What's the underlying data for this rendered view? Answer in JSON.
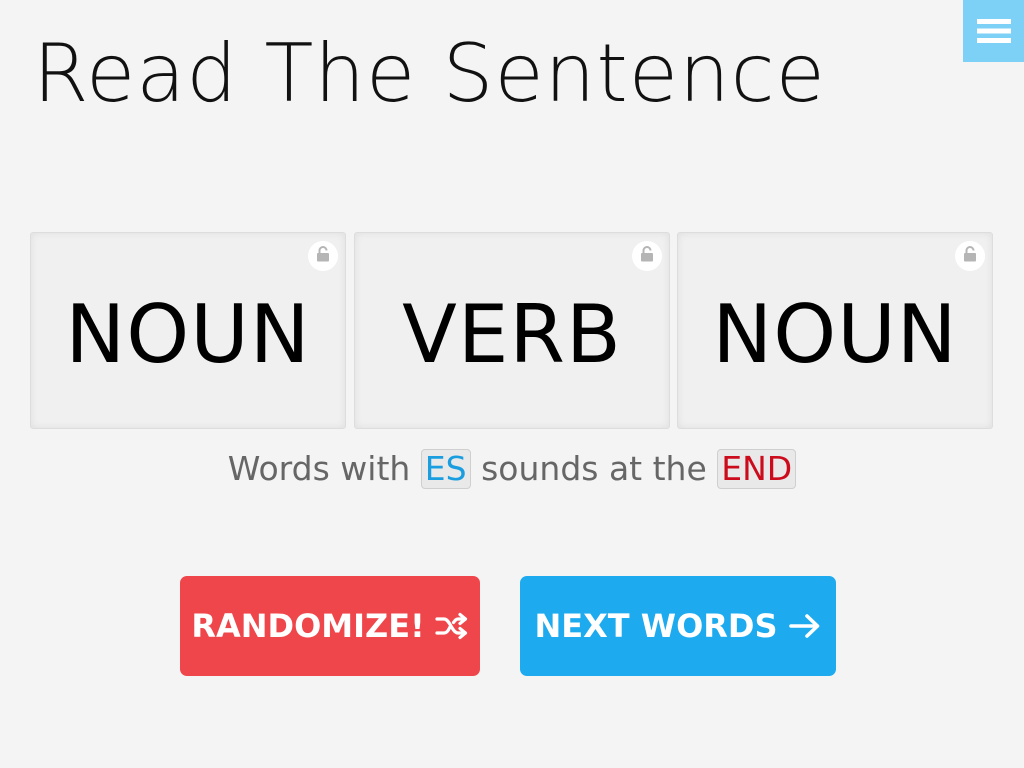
{
  "header": {
    "title": "Read The Sentence",
    "menu_icon": "hamburger-menu-icon",
    "menu_color": "#7dd0f6"
  },
  "cards": [
    {
      "word": "NOUN",
      "icon": "lock-icon"
    },
    {
      "word": "VERB",
      "icon": "lock-icon"
    },
    {
      "word": "NOUN",
      "icon": "lock-icon"
    }
  ],
  "hint": {
    "prefix": "Words with",
    "sound": "ES",
    "middle": "sounds at the",
    "position": "END",
    "sound_color": "#1a9ee0",
    "position_color": "#cc0c1c"
  },
  "buttons": {
    "randomize_label": "RANDOMIZE!",
    "randomize_icon": "shuffle-icon",
    "randomize_color": "#ef464b",
    "next_label": "NEXT WORDS",
    "next_icon": "arrow-right-icon",
    "next_color": "#1daaee"
  }
}
